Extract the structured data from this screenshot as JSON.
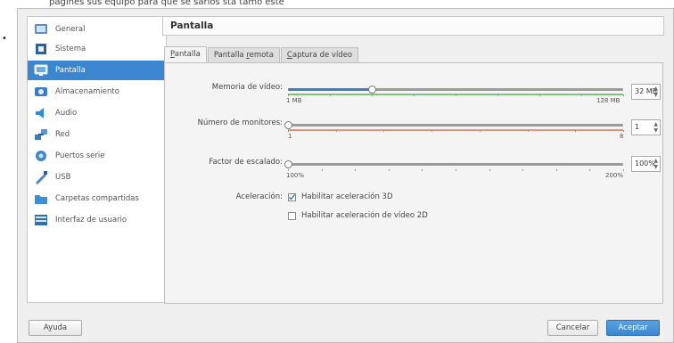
{
  "clipped_top_text": "pagines sus equipo para que se sarios  sta tamo este",
  "dialog": {
    "header_title": "Pantalla",
    "sidebar": {
      "items": [
        {
          "label": "General",
          "icon": "general-icon"
        },
        {
          "label": "Sistema",
          "icon": "system-chip-icon"
        },
        {
          "label": "Pantalla",
          "icon": "monitor-icon",
          "selected": true
        },
        {
          "label": "Almacenamiento",
          "icon": "storage-disk-icon"
        },
        {
          "label": "Audio",
          "icon": "speaker-icon"
        },
        {
          "label": "Red",
          "icon": "network-icon"
        },
        {
          "label": "Puertos serie",
          "icon": "serial-port-icon"
        },
        {
          "label": "USB",
          "icon": "usb-icon"
        },
        {
          "label": "Carpetas compartidas",
          "icon": "shared-folder-icon"
        },
        {
          "label": "Interfaz de usuario",
          "icon": "user-interface-icon"
        }
      ]
    },
    "tabs": [
      {
        "label_pre": "",
        "label_u": "P",
        "label_post": "antalla",
        "active": true
      },
      {
        "label_pre": "Pantalla ",
        "label_u": "r",
        "label_post": "emota",
        "active": false
      },
      {
        "label_pre": "",
        "label_u": "C",
        "label_post": "aptura de vídeo",
        "active": false
      }
    ],
    "screen": {
      "video_memory": {
        "label": "Memoria de vídeo:",
        "min_label": "1 MB",
        "max_label": "128 MB",
        "value_text": "32 MB",
        "fraction": 0.25
      },
      "monitors": {
        "label": "Número de monitores:",
        "min_label": "1",
        "max_label": "8",
        "value_text": "1",
        "fraction": 0.0
      },
      "scale_factor": {
        "label": "Factor de escalado:",
        "min_label": "100%",
        "max_label": "200%",
        "value_text": "100%",
        "fraction": 0.0
      },
      "acceleration": {
        "label": "Aceleración:",
        "enable_3d": {
          "label": "Habilitar aceleración 3D",
          "checked": true
        },
        "enable_2d": {
          "label": "Habilitar aceleración de vídeo 2D",
          "checked": false
        }
      }
    },
    "buttons": {
      "help": "Ayuda",
      "cancel": "Cancelar",
      "accept": "Aceptar"
    }
  },
  "colors": {
    "selection": "#3b86cf",
    "slider_fill": "#3b7ec4",
    "zone_green": "#7cc67c",
    "zone_red": "#e8937a"
  }
}
